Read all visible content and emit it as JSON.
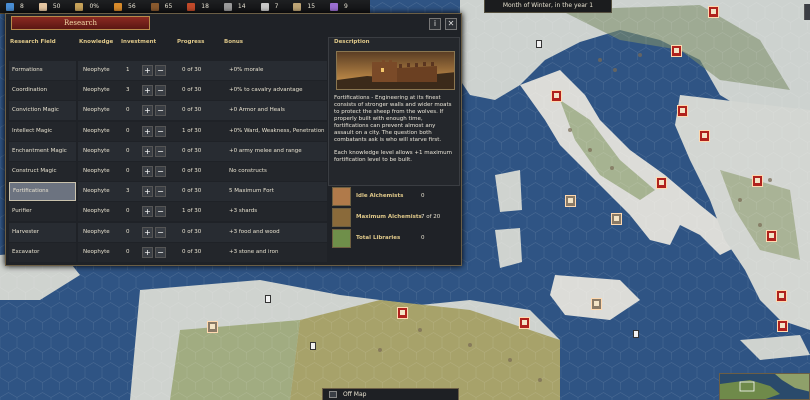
{
  "top_bar": {
    "resources": [
      {
        "icon": "scroll-icon",
        "value": "8",
        "color": "#4a8fd6"
      },
      {
        "icon": "population-icon",
        "value": "50",
        "color": "#e6c7a2"
      },
      {
        "icon": "unrest-icon",
        "value": "0%",
        "color": "#c8a35a"
      },
      {
        "icon": "food-icon",
        "value": "56",
        "color": "#d98b2b"
      },
      {
        "icon": "wood-icon",
        "value": "65",
        "color": "#8a5a2e"
      },
      {
        "icon": "stone-icon",
        "value": "18",
        "color": "#c24a2a"
      },
      {
        "icon": "iron-icon",
        "value": "14",
        "color": "#9b9b9b"
      },
      {
        "icon": "weapon-icon",
        "value": "7",
        "color": "#c9c9c9"
      },
      {
        "icon": "book-icon",
        "value": "15",
        "color": "#bfa676"
      },
      {
        "icon": "mana-icon",
        "value": "9",
        "color": "#9b6fd1"
      }
    ],
    "date": "Month of Winter, in the year 1"
  },
  "research_window": {
    "title": "Research",
    "info_button": "i",
    "close_button": "✕",
    "headers": {
      "field": "Research Field",
      "knowledge": "Knowledge",
      "investment": "Investment",
      "progress": "Progress",
      "bonus": "Bonus"
    },
    "rows": [
      {
        "field": "Formations",
        "knowledge": "Neophyte",
        "investment": "1",
        "progress": "0 of 30",
        "bonus": "+0% morale"
      },
      {
        "field": "Coordination",
        "knowledge": "Neophyte",
        "investment": "3",
        "progress": "0 of 30",
        "bonus": "+0% to cavalry advantage"
      },
      {
        "field": "Conviction Magic",
        "knowledge": "Neophyte",
        "investment": "0",
        "progress": "0 of 30",
        "bonus": "+0 Armor and Heals"
      },
      {
        "field": "Intellect Magic",
        "knowledge": "Neophyte",
        "investment": "0",
        "progress": "1 of 30",
        "bonus": "+0% Ward, Weakness, Penetration"
      },
      {
        "field": "Enchantment Magic",
        "knowledge": "Neophyte",
        "investment": "0",
        "progress": "0 of 30",
        "bonus": "+0 army melee and range"
      },
      {
        "field": "Construct Magic",
        "knowledge": "Neophyte",
        "investment": "0",
        "progress": "0 of 30",
        "bonus": "No constructs"
      },
      {
        "field": "Fortifications",
        "knowledge": "Neophyte",
        "investment": "3",
        "progress": "0 of 30",
        "bonus": "5 Maximum Fort",
        "selected": true
      },
      {
        "field": "Purifier",
        "knowledge": "Neophyte",
        "investment": "0",
        "progress": "1 of 30",
        "bonus": "+3 shards"
      },
      {
        "field": "Harvester",
        "knowledge": "Neophyte",
        "investment": "0",
        "progress": "0 of 30",
        "bonus": "+3 food and wood"
      },
      {
        "field": "Excavator",
        "knowledge": "Neophyte",
        "investment": "0",
        "progress": "0 of 30",
        "bonus": "+3 stone and iron"
      }
    ],
    "description": {
      "title": "Description",
      "paragraph1": "Fortifications - Engineering at its finest consists of stronger walls and wider moats to protect the sheep from the wolves. If properly built with enough time, fortifications can prevent almost any assault on a city. The question both combatants ask is who will starve first.",
      "paragraph2": "Each knowledge level allows +1 maximum fortification level to be built."
    },
    "stats": [
      {
        "icon": "alchemist-icon",
        "label": "Idle Alchemists",
        "value": "0"
      },
      {
        "icon": "alchemist-max-icon",
        "label": "Maximum Alchemists",
        "value": "7 of 20"
      },
      {
        "icon": "library-icon",
        "label": "Total Libraries",
        "value": "0"
      }
    ],
    "plus_symbol": "+",
    "minus_symbol": "−"
  },
  "bottom": {
    "offmap_label": "Off Map"
  }
}
